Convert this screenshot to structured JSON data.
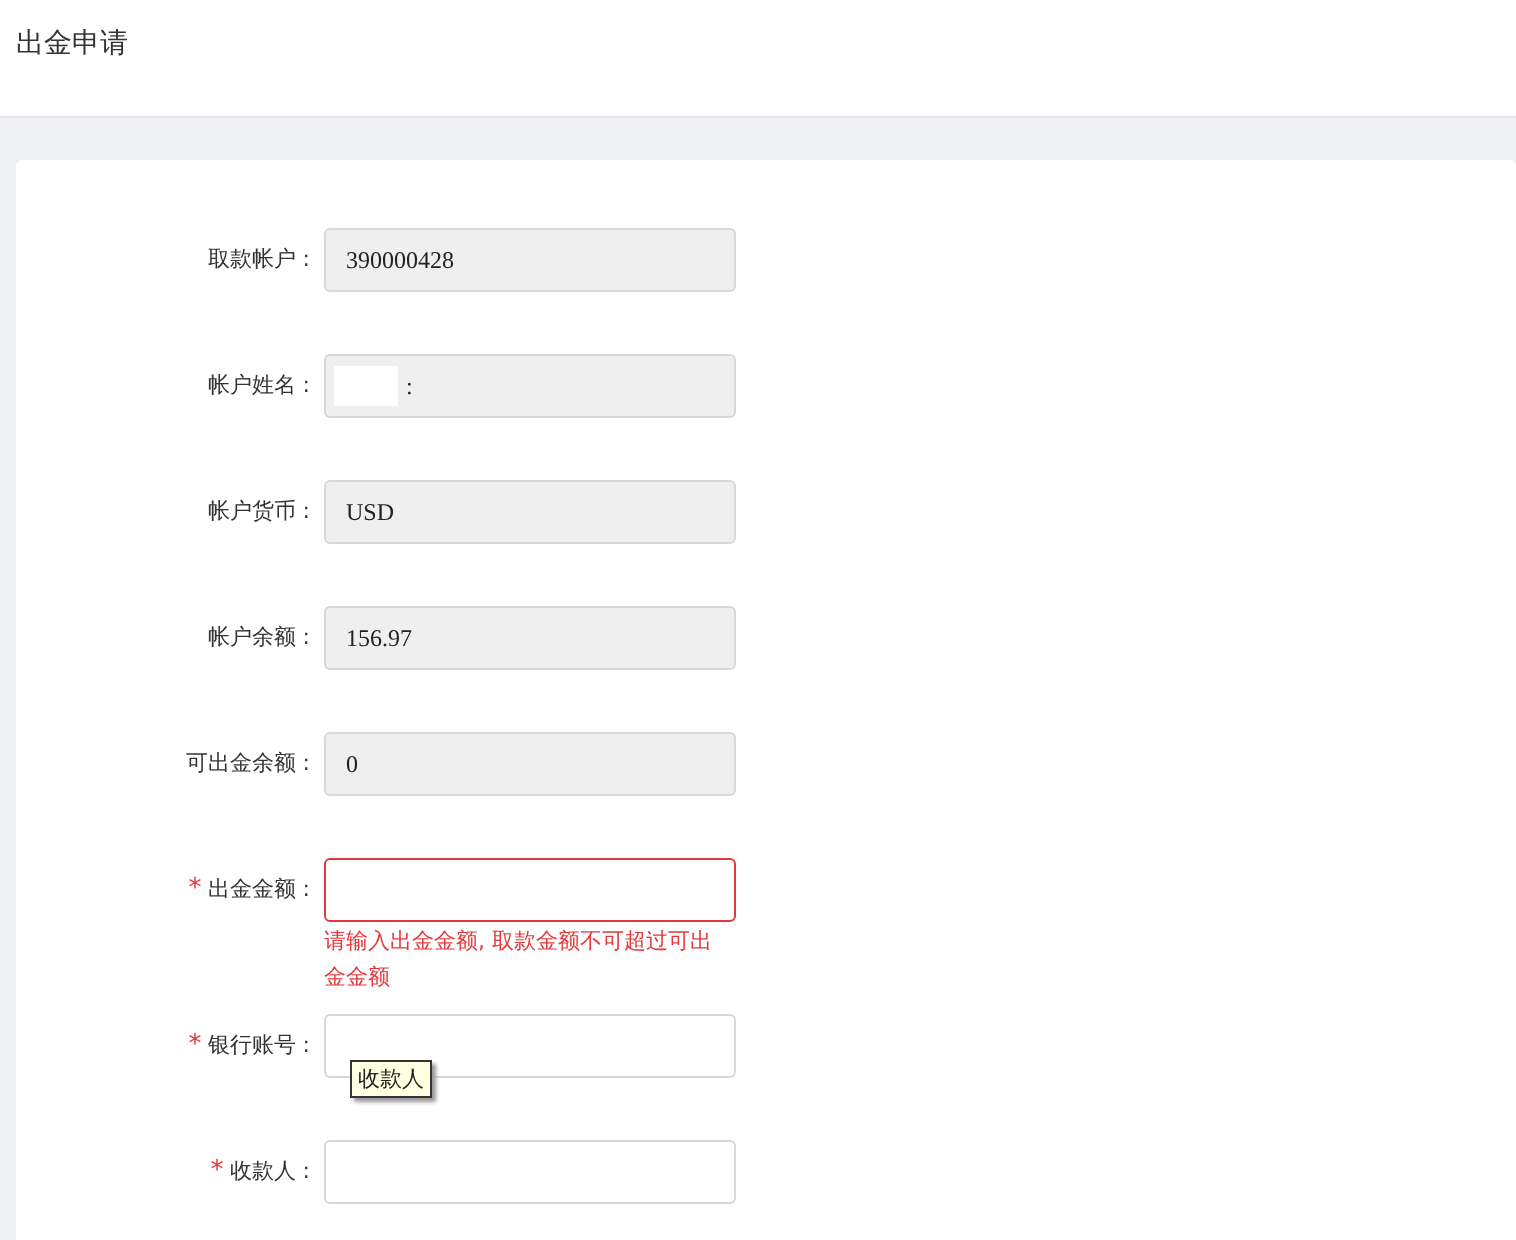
{
  "page_title": "出金申请",
  "fields": [
    {
      "label": "取款帐户 :",
      "required": false,
      "readonly": true,
      "value": "390000428"
    },
    {
      "label": "帐户姓名 :",
      "required": false,
      "readonly": true,
      "redacted": true,
      "value": ":"
    },
    {
      "label": "帐户货币 :",
      "required": false,
      "readonly": true,
      "value": "USD"
    },
    {
      "label": "帐户余额 :",
      "required": false,
      "readonly": true,
      "value": "156.97"
    },
    {
      "label": "可出金余额 :",
      "required": false,
      "readonly": true,
      "value": "0"
    },
    {
      "label": "出金金额 :",
      "required": true,
      "readonly": false,
      "invalid": true,
      "error": "请输入出金金额, 取款金额不可超过可出金金额"
    },
    {
      "label": "银行账号 :",
      "required": true,
      "readonly": false,
      "tooltip": "收款人"
    },
    {
      "label": "收款人 :",
      "required": true,
      "readonly": false
    }
  ],
  "required_mark": "*"
}
